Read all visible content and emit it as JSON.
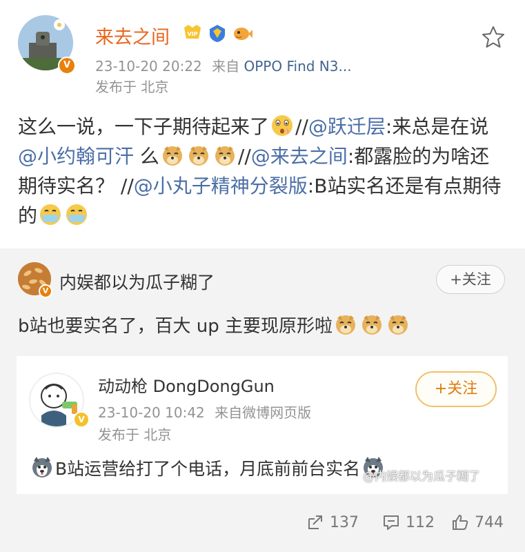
{
  "post": {
    "author": "来去之间",
    "badges": [
      "vip-badge-icon",
      "verified-shield-icon",
      "fish-badge-icon"
    ],
    "timestamp": "23-10-20 20:22",
    "from_prefix": "来自",
    "source": "OPPO Find N3...",
    "location": "发布于 北京",
    "content": {
      "s1": "这么一说，一下子期待起来了",
      "s2": "//",
      "m1": "@跃迁层",
      "s3": ":来总是在说",
      "m2": "@小约翰可汗",
      "s4": " 么",
      "s5": "//",
      "m3": "@来去之间",
      "s6": ":都露脸的为啥还期待实名？ //",
      "m4": "@小丸子精神分裂版",
      "s7": ":B站实名还是有点期待的"
    }
  },
  "repost": {
    "author": "内娱都以为瓜子糊了",
    "follow_label": "+关注",
    "text": "b站也要实名了，百大 up 主要现原形啦",
    "card": {
      "author": "动动枪 DongDongGun",
      "follow_label": "+关注",
      "timestamp": "23-10-20 10:42",
      "from_prefix": "来自",
      "source": "微博网页版",
      "location": "发布于 北京",
      "text": "B站运营给打了个电话，月底前前台实名",
      "watermark": "@内娱都以为瓜子糊了"
    }
  },
  "actions": {
    "repost_count": "137",
    "comment_count": "112",
    "like_count": "744"
  },
  "colors": {
    "author_orange": "#e8651d",
    "mention_blue": "#4a6ea6",
    "meta_gray": "#939393",
    "follow_orange": "#e07a12"
  }
}
